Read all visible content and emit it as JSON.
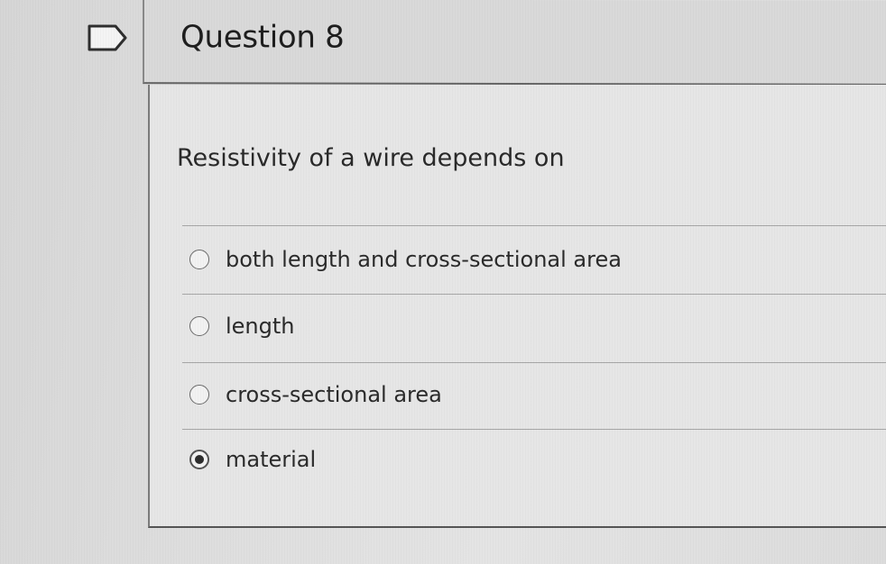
{
  "question": {
    "title": "Question 8",
    "prompt": "Resistivity of a wire depends on",
    "options": [
      {
        "label": "both length and cross-sectional area",
        "selected": false
      },
      {
        "label": "length",
        "selected": false
      },
      {
        "label": "cross-sectional area",
        "selected": false
      },
      {
        "label": "material",
        "selected": true
      }
    ]
  },
  "icons": {
    "flag": "flag-icon"
  }
}
